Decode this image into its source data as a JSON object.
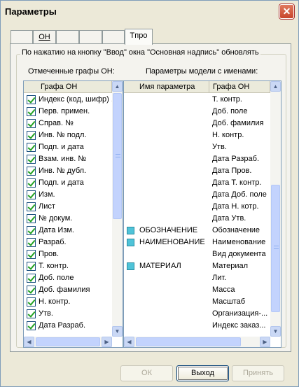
{
  "window": {
    "title": "Параметры",
    "close_glyph": "✕"
  },
  "tabs": [
    {
      "label": ""
    },
    {
      "label": "ОН"
    },
    {
      "label": ""
    },
    {
      "label": ""
    },
    {
      "label": ""
    },
    {
      "label": "Tпро"
    }
  ],
  "group": {
    "legend": "По нажатию на кнопку \"Ввод\" окна \"Основная надпись\" обновлять",
    "left_caption": "Отмеченные графы ОН:",
    "right_caption": "Параметры модели с именами:"
  },
  "left_list": {
    "header": "Графа ОН",
    "items": [
      "Индекс (код, шифр) ...",
      "Перв. примен.",
      "Справ. №",
      "Инв. № подл.",
      "Подп. и дата",
      "Взам. инв. №",
      "Инв. № дубл.",
      "Подп. и дата",
      "Изм.",
      "Лист",
      "№ докум.",
      "Дата Изм.",
      "Разраб.",
      "Пров.",
      "Т. контр.",
      "Доб. поле",
      "Доб. фамилия",
      "Н. контр.",
      "Утв.",
      "Дата Разраб."
    ]
  },
  "right_list": {
    "header_name": "Имя параметра",
    "header_graf": "Графа ОН",
    "rows": [
      {
        "name": "",
        "graf": "Т. контр.",
        "icon": false
      },
      {
        "name": "",
        "graf": "Доб. поле",
        "icon": false
      },
      {
        "name": "",
        "graf": "Доб. фамилия",
        "icon": false
      },
      {
        "name": "",
        "graf": "Н. контр.",
        "icon": false
      },
      {
        "name": "",
        "graf": "Утв.",
        "icon": false
      },
      {
        "name": "",
        "graf": "Дата Разраб.",
        "icon": false
      },
      {
        "name": "",
        "graf": "Дата Пров.",
        "icon": false
      },
      {
        "name": "",
        "graf": "Дата Т. контр.",
        "icon": false
      },
      {
        "name": "",
        "graf": "Дата Доб. поле",
        "icon": false
      },
      {
        "name": "",
        "graf": "Дата Н. котр.",
        "icon": false
      },
      {
        "name": "",
        "graf": "Дата Утв.",
        "icon": false
      },
      {
        "name": "ОБОЗНАЧЕНИЕ",
        "graf": "Обозначение",
        "icon": true
      },
      {
        "name": "НАИМЕНОВАНИЕ",
        "graf": "Наименование",
        "icon": true
      },
      {
        "name": "",
        "graf": "Вид документа",
        "icon": false
      },
      {
        "name": "МАТЕРИАЛ",
        "graf": "Материал",
        "icon": true
      },
      {
        "name": "",
        "graf": "Лит.",
        "icon": false
      },
      {
        "name": "",
        "graf": "Масса",
        "icon": false
      },
      {
        "name": "",
        "graf": "Масштаб",
        "icon": false
      },
      {
        "name": "",
        "graf": "Организация-...",
        "icon": false
      },
      {
        "name": "",
        "graf": "Индекс заказ...",
        "icon": false
      }
    ]
  },
  "buttons": {
    "ok": "ОК",
    "exit": "Выход",
    "apply": "Принять"
  },
  "icons": {
    "checkbox": "checkbox-checked-icon",
    "param": "model-param-icon"
  },
  "colors": {
    "window_bg": "#ece9d8",
    "checkbox_check": "#21a121",
    "param_icon": "#4fc3d8"
  }
}
